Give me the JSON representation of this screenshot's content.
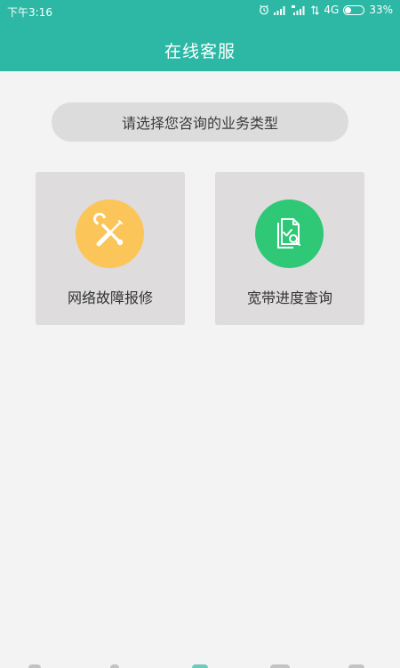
{
  "status_bar": {
    "time": "下午3:16",
    "network": "4G",
    "battery": "33%",
    "battery_level": 0.33
  },
  "header": {
    "title": "在线客服"
  },
  "prompt": {
    "text": "请选择您咨询的业务类型"
  },
  "cards": [
    {
      "label": "网络故障报修",
      "icon": "repair-tools-icon",
      "color": "#fbc55a"
    },
    {
      "label": "宽带进度查询",
      "icon": "document-search-icon",
      "color": "#2ec877"
    }
  ],
  "colors": {
    "header_bg": "#2db8a5",
    "page_bg": "#f3f3f3",
    "card_bg": "#dedcdc",
    "pill_bg": "#dcdcdc"
  }
}
